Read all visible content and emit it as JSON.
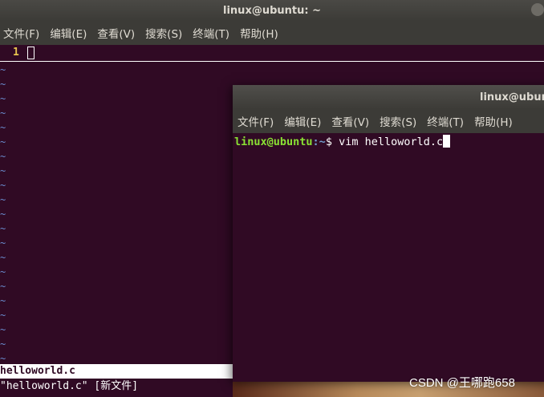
{
  "back_window": {
    "title": "linux@ubuntu: ~",
    "menu": [
      "文件(F)",
      "编辑(E)",
      "查看(V)",
      "搜索(S)",
      "终端(T)",
      "帮助(H)"
    ]
  },
  "vim": {
    "line_number": "1",
    "tilde": "~",
    "status_filename": "helloworld.c",
    "message": "\"helloworld.c\" [新文件]"
  },
  "front_window": {
    "title": "linux@ubun",
    "menu": [
      "文件(F)",
      "编辑(E)",
      "查看(V)",
      "搜索(S)",
      "终端(T)",
      "帮助(H)"
    ],
    "prompt_user": "linux@ubuntu",
    "prompt_path": ":~",
    "prompt_symbol": "$ ",
    "command": "vim helloworld.c"
  },
  "watermark": "CSDN @王哪跑658",
  "colors": {
    "terminal_bg": "#300a24",
    "prompt_green": "#8ae234",
    "prompt_blue": "#729fcf"
  }
}
